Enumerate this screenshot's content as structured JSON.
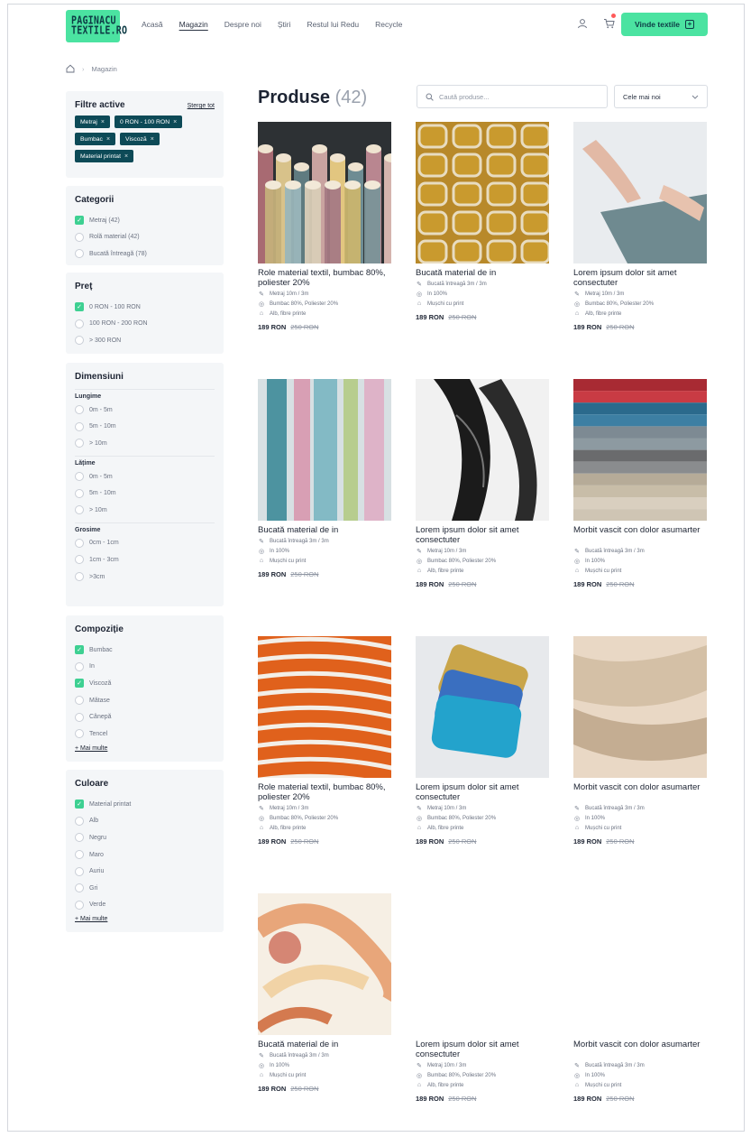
{
  "header": {
    "logo_line1": "PAGINACU",
    "logo_line2": "TEXTILE.RO",
    "nav": [
      "Acasă",
      "Magazin",
      "Despre noi",
      "Știri",
      "Restul lui Redu",
      "Recycle"
    ],
    "active_nav": "Magazin",
    "cta_label": "Vinde textile",
    "colors": {
      "accent": "#4be3a1",
      "chip": "#0d4a57",
      "check": "#3ed092"
    }
  },
  "breadcrumb": {
    "current": "Magazin"
  },
  "filters": {
    "active_title": "Filtre active",
    "clear_label": "Șterge tot",
    "chips": [
      "Metraj",
      "0 RON - 100 RON",
      "Bumbac",
      "Viscoză",
      "Material printat"
    ],
    "categories": {
      "title": "Categorii",
      "options": [
        {
          "label": "Metraj (42)",
          "checked": true
        },
        {
          "label": "Rolă material (42)",
          "checked": false
        },
        {
          "label": "Bucată întreagă (78)",
          "checked": false
        }
      ]
    },
    "price": {
      "title": "Preț",
      "options": [
        {
          "label": "0 RON - 100 RON",
          "checked": true
        },
        {
          "label": "100 RON - 200 RON",
          "checked": false
        },
        {
          "label": "> 300 RON",
          "checked": false
        }
      ]
    },
    "dimensions": {
      "title": "Dimensiuni",
      "groups": [
        {
          "label": "Lungime",
          "options": [
            "0m - 5m",
            "5m - 10m",
            "> 10m"
          ]
        },
        {
          "label": "Lățime",
          "options": [
            "0m - 5m",
            "5m - 10m",
            "> 10m"
          ]
        },
        {
          "label": "Grosime",
          "options": [
            "0cm - 1cm",
            "1cm - 3cm",
            ">3cm"
          ]
        }
      ]
    },
    "composition": {
      "title": "Compoziție",
      "options": [
        {
          "label": "Bumbac",
          "checked": true
        },
        {
          "label": "In",
          "checked": false
        },
        {
          "label": "Viscoză",
          "checked": true
        },
        {
          "label": "Mătase",
          "checked": false
        },
        {
          "label": "Cânepă",
          "checked": false
        },
        {
          "label": "Tencel",
          "checked": false
        }
      ],
      "more": "+ Mai multe"
    },
    "color": {
      "title": "Culoare",
      "options": [
        {
          "label": "Material printat",
          "checked": true
        },
        {
          "label": "Alb",
          "checked": false
        },
        {
          "label": "Negru",
          "checked": false
        },
        {
          "label": "Maro",
          "checked": false
        },
        {
          "label": "Auriu",
          "checked": false
        },
        {
          "label": "Gri",
          "checked": false
        },
        {
          "label": "Verde",
          "checked": false
        }
      ],
      "more": "+ Mai multe"
    }
  },
  "main": {
    "title": "Produse",
    "count": "(42)",
    "search_placeholder": "Caută produse...",
    "sort_label": "Cele mai noi"
  },
  "products": [
    {
      "name": "Role material textil, bumbac 80%, poliester 20%",
      "specs": [
        "Metraj 10m / 3m",
        "Bumbac 80%, Poliester 20%",
        "Alb, fibre printe"
      ],
      "price": "189 RON",
      "old_price": "250 RON",
      "image": "cylinders"
    },
    {
      "name": "Bucată material de in",
      "specs": [
        "Bucată întreagă 3m / 3m",
        "In 100%",
        "Mușchi cu print"
      ],
      "price": "189 RON",
      "old_price": "250 RON",
      "image": "mustard"
    },
    {
      "name": "Lorem ipsum dolor sit amet consectuter",
      "specs": [
        "Metraj 10m / 3m",
        "Bumbac 80%, Poliester 20%",
        "Alb, fibre printe"
      ],
      "price": "189 RON",
      "old_price": "250 RON",
      "image": "hands"
    },
    {
      "name": "Bucată material de in",
      "specs": [
        "Bucată întreagă 3m / 3m",
        "In 100%",
        "Mușchi cu print"
      ],
      "price": "189 RON",
      "old_price": "250 RON",
      "image": "abstract"
    },
    {
      "name": "Lorem ipsum dolor sit amet consectuter",
      "specs": [
        "Metraj 10m / 3m",
        "Bumbac 80%, Poliester 20%",
        "Alb, fibre printe"
      ],
      "price": "189 RON",
      "old_price": "250 RON",
      "image": "black"
    },
    {
      "name": "Morbit vascit con dolor asumarter",
      "specs": [
        "Bucată întreagă 3m / 3m",
        "In 100%",
        "Mușchi cu print"
      ],
      "price": "189 RON",
      "old_price": "250 RON",
      "image": "stripes"
    },
    {
      "name": "Role material textil, bumbac 80%, poliester 20%",
      "specs": [
        "Metraj 10m / 3m",
        "Bumbac 80%, Poliester 20%",
        "Alb, fibre printe"
      ],
      "price": "189 RON",
      "old_price": "250 RON",
      "image": "orange"
    },
    {
      "name": "Lorem ipsum dolor sit amet consectuter",
      "specs": [
        "Metraj 10m / 3m",
        "Bumbac 80%, Poliester 20%",
        "Alb, fibre printe"
      ],
      "price": "189 RON",
      "old_price": "250 RON",
      "image": "folded"
    },
    {
      "name": "Morbit vascit con dolor asumarter",
      "specs": [
        "Bucată întreagă 3m / 3m",
        "In 100%",
        "Mușchi cu print"
      ],
      "price": "189 RON",
      "old_price": "250 RON",
      "image": "beige"
    },
    {
      "name": "Bucată material de in",
      "specs": [
        "Bucată întreagă 3m / 3m",
        "In 100%",
        "Mușchi cu print"
      ],
      "price": "189 RON",
      "old_price": "250 RON",
      "image": "swirl"
    },
    {
      "name": "Lorem ipsum dolor sit amet consectuter",
      "specs": [
        "Metraj 10m / 3m",
        "Bumbac 80%, Poliester 20%",
        "Alb, fibre printe"
      ],
      "price": "189 RON",
      "old_price": "250 RON",
      "image": "none"
    },
    {
      "name": "Morbit vascit con dolor asumarter",
      "specs": [
        "Bucată întreagă 3m / 3m",
        "In 100%",
        "Mușchi cu print"
      ],
      "price": "189 RON",
      "old_price": "250 RON",
      "image": "none"
    }
  ]
}
